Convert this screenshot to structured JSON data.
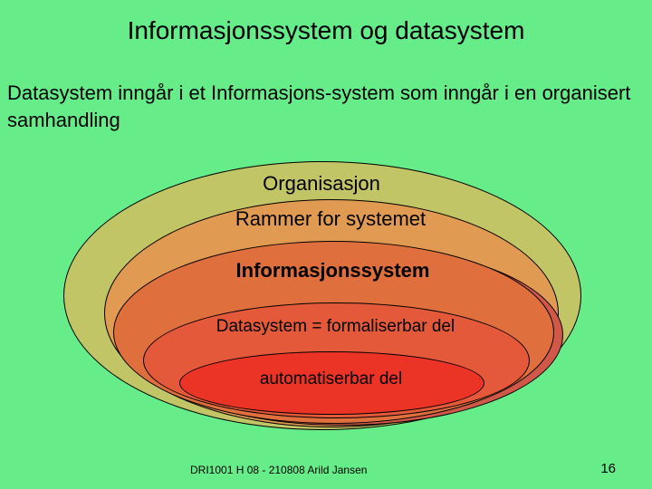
{
  "title": "Informasjonssystem og datasystem",
  "subtitle_html": "Datasystem inngår i et Informasjons-system som inngår i en organisert samhandling",
  "layers": {
    "organisasjon": "Organisasjon",
    "rammer": "Rammer for systemet",
    "informasjonssystem": "Informasjonssystem",
    "datasystem": "Datasystem = formaliserbar del",
    "automatiserbar": "automatiserbar del"
  },
  "footer": "DRI1001 H 08 -  210808  Arild Jansen",
  "page_number": "16",
  "chart_data": {
    "type": "nested-ellipse-diagram",
    "title": "Informasjonssystem og datasystem",
    "description": "Nested containment: Organisasjon ⊃ Rammer for systemet ⊃ Informasjonssystem ⊃ Datasystem (formaliserbar del) ⊃ automatiserbar del",
    "levels": [
      {
        "order": 1,
        "label": "Organisasjon",
        "color": "#c2c565"
      },
      {
        "order": 2,
        "label": "Rammer for systemet",
        "color": "#e19a51"
      },
      {
        "order": 3,
        "label": "Informasjonssystem",
        "color": "#df6f3c"
      },
      {
        "order": 4,
        "label": "Datasystem = formaliserbar del",
        "color": "#e3593a"
      },
      {
        "order": 5,
        "label": "automatiserbar del",
        "color": "#eb3426"
      }
    ]
  }
}
